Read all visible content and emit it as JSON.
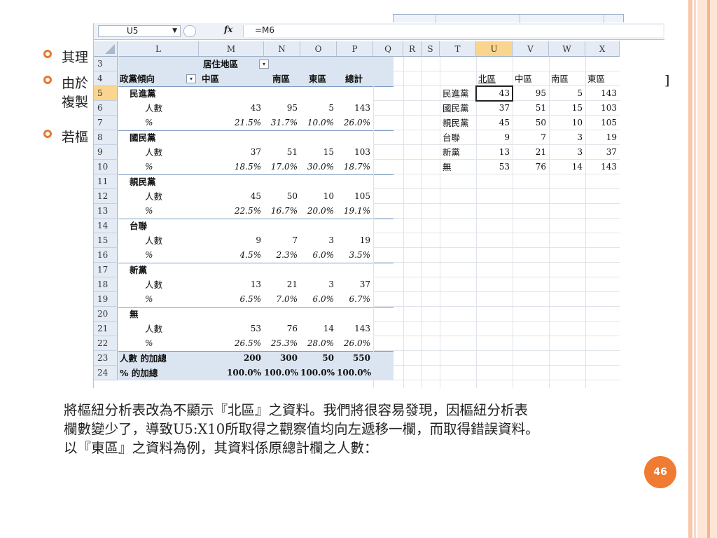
{
  "slide": {
    "bullets": [
      "其理",
      "由於",
      "若樞"
    ],
    "bullet2_line2": "複製",
    "bullet2_trail": "]",
    "paragraph": [
      "將樞紐分析表改為不顯示『北區』之資料。我們將很容易發現，因樞紐分析表",
      "欄數變少了，導致U5:X10所取得之觀察值均向左遞移一欄，而取得錯誤資料。",
      "以『東區』之資料為例，其資料係原總計欄之人數："
    ],
    "page_number": "46"
  },
  "excel": {
    "name_box": "U5",
    "formula": "=M6",
    "fx_label": "fx",
    "columns": [
      "L",
      "M",
      "N",
      "O",
      "P",
      "Q",
      "R",
      "S",
      "T",
      "U",
      "V",
      "W",
      "X"
    ],
    "rows": [
      "3",
      "4",
      "5",
      "6",
      "7",
      "8",
      "9",
      "10",
      "11",
      "12",
      "13",
      "14",
      "15",
      "16",
      "17",
      "18",
      "19",
      "20",
      "21",
      "22",
      "23",
      "24"
    ],
    "pivot": {
      "col_field": "居住地區",
      "row_field": "政黨傾向",
      "headers": [
        "中區",
        "南區",
        "東區",
        "總計"
      ],
      "parties": [
        {
          "name": "民進黨",
          "count_label": "人數",
          "counts": [
            "43",
            "95",
            "5",
            "143"
          ],
          "pct_label": "%",
          "pcts": [
            "21.5%",
            "31.7%",
            "10.0%",
            "26.0%"
          ]
        },
        {
          "name": "國民黨",
          "count_label": "人數",
          "counts": [
            "37",
            "51",
            "15",
            "103"
          ],
          "pct_label": "%",
          "pcts": [
            "18.5%",
            "17.0%",
            "30.0%",
            "18.7%"
          ]
        },
        {
          "name": "親民黨",
          "count_label": "人數",
          "counts": [
            "45",
            "50",
            "10",
            "105"
          ],
          "pct_label": "%",
          "pcts": [
            "22.5%",
            "16.7%",
            "20.0%",
            "19.1%"
          ]
        },
        {
          "name": "台聯",
          "count_label": "人數",
          "counts": [
            "9",
            "7",
            "3",
            "19"
          ],
          "pct_label": "%",
          "pcts": [
            "4.5%",
            "2.3%",
            "6.0%",
            "3.5%"
          ]
        },
        {
          "name": "新黨",
          "count_label": "人數",
          "counts": [
            "13",
            "21",
            "3",
            "37"
          ],
          "pct_label": "%",
          "pcts": [
            "6.5%",
            "7.0%",
            "6.0%",
            "6.7%"
          ]
        },
        {
          "name": "無",
          "count_label": "人數",
          "counts": [
            "53",
            "76",
            "14",
            "143"
          ],
          "pct_label": "%",
          "pcts": [
            "26.5%",
            "25.3%",
            "28.0%",
            "26.0%"
          ]
        }
      ],
      "total_count_label": "人數 的加總",
      "total_counts": [
        "200",
        "300",
        "50",
        "550"
      ],
      "total_pct_label": "% 的加總",
      "total_pcts": [
        "100.0%",
        "100.0%",
        "100.0%",
        "100.0%"
      ]
    },
    "side_table": {
      "headers": [
        "北區",
        "中區",
        "南區",
        "東區"
      ],
      "rows": [
        {
          "label": "民進黨",
          "values": [
            "43",
            "95",
            "5",
            "143"
          ]
        },
        {
          "label": "國民黨",
          "values": [
            "37",
            "51",
            "15",
            "103"
          ]
        },
        {
          "label": "親民黨",
          "values": [
            "45",
            "50",
            "10",
            "105"
          ]
        },
        {
          "label": "台聯",
          "values": [
            "9",
            "7",
            "3",
            "19"
          ]
        },
        {
          "label": "新黨",
          "values": [
            "13",
            "21",
            "3",
            "37"
          ]
        },
        {
          "label": "無",
          "values": [
            "53",
            "76",
            "14",
            "143"
          ]
        }
      ]
    }
  },
  "colors": {
    "accent": "#f07b32",
    "pivot_shade": "#dbe5f1",
    "selected_header": "#f9d58e"
  }
}
